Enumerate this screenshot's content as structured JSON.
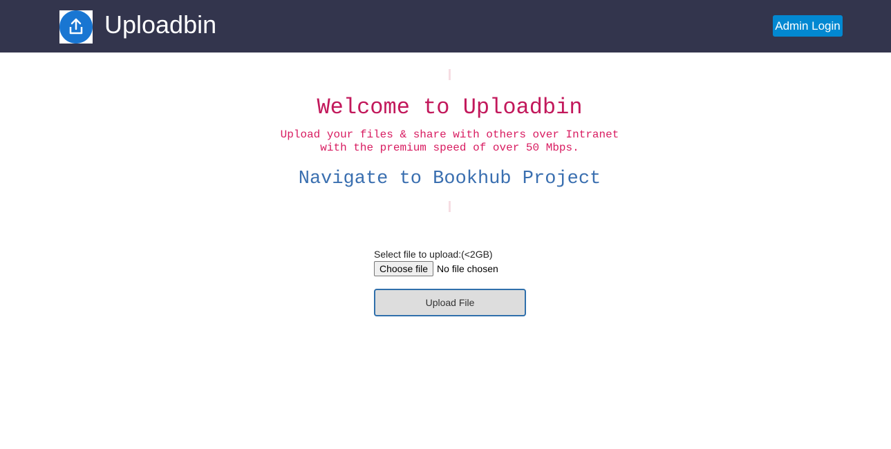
{
  "header": {
    "brand": "Uploadbin",
    "logo_icon": "upload-icon",
    "admin_login_label": "Admin Login",
    "background_color": "#33354d",
    "admin_button_color": "#0288d1"
  },
  "hero": {
    "welcome_title": "Welcome to Uploadbin",
    "subtitle_line1": "Upload your files & share with others over Intranet",
    "subtitle_line2": "with the premium speed of over 50 Mbps.",
    "navigate_link": "Navigate to Bookhub Project",
    "title_color": "#c2185b",
    "link_color": "#3a6fb0"
  },
  "upload_form": {
    "label": "Select file to upload:(<2GB)",
    "choose_file_label": "Choose file",
    "no_file_text": "No file chosen",
    "submit_label": "Upload File"
  }
}
